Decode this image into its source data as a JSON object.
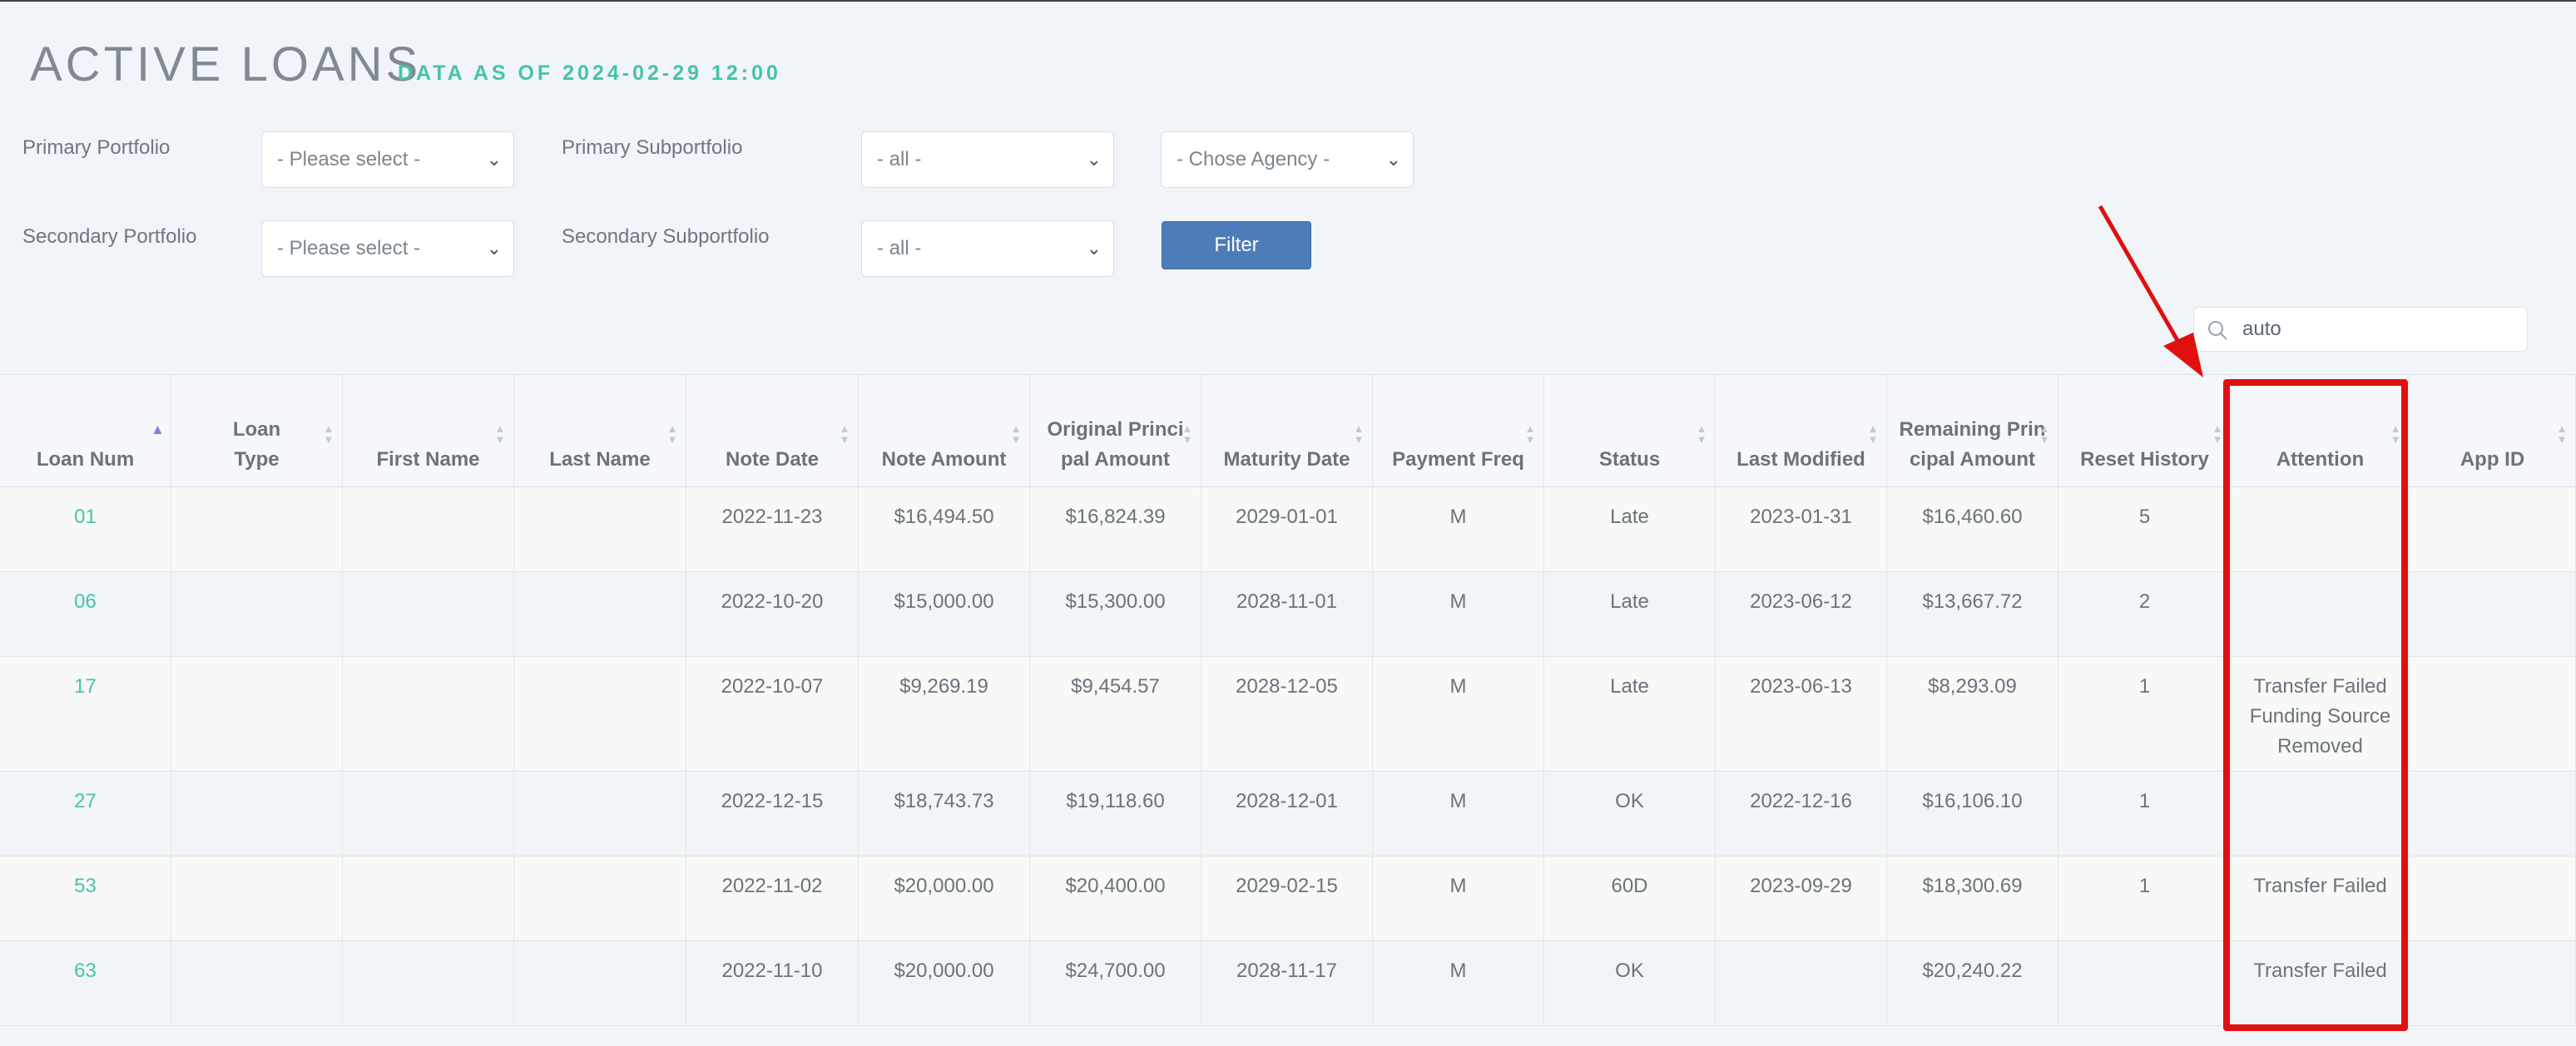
{
  "header": {
    "title": "ACTIVE LOANS",
    "subtitle": "DATA AS OF 2024-02-29 12:00"
  },
  "filters": {
    "primary_portfolio_label": "Primary Portfolio",
    "primary_portfolio_value": "- Please select -",
    "primary_subportfolio_label": "Primary Subportfolio",
    "primary_subportfolio_value": "- all -",
    "agency_value": "- Chose Agency -",
    "secondary_portfolio_label": "Secondary Portfolio",
    "secondary_portfolio_value": "- Please select -",
    "secondary_subportfolio_label": "Secondary Subportfolio",
    "secondary_subportfolio_value": "- all -",
    "filter_button": "Filter"
  },
  "search": {
    "value": "auto"
  },
  "table": {
    "columns": [
      {
        "label": "Loan Num"
      },
      {
        "label": "Loan Type"
      },
      {
        "label": "First Name"
      },
      {
        "label": "Last Name"
      },
      {
        "label": "Note Date"
      },
      {
        "label": "Note Amount"
      },
      {
        "label": "Original Principal Amount"
      },
      {
        "label": "Maturity Date"
      },
      {
        "label": "Payment Freq"
      },
      {
        "label": "Status"
      },
      {
        "label": "Last Modified"
      },
      {
        "label": "Remaining Principal Amount"
      },
      {
        "label": "Reset History"
      },
      {
        "label": "Attention"
      },
      {
        "label": "App ID"
      }
    ],
    "rows": [
      {
        "loan": "01",
        "type": "",
        "first": "",
        "last": "",
        "note_date": "2022-11-23",
        "note_amount": "$16,494.50",
        "orig_principal": "$16,824.39",
        "maturity": "2029-01-01",
        "freq": "M",
        "status": "Late",
        "last_modified": "2023-01-31",
        "remaining": "$16,460.60",
        "reset": "5",
        "attention": "",
        "app_id": ""
      },
      {
        "loan": "06",
        "type": "",
        "first": "",
        "last": "",
        "note_date": "2022-10-20",
        "note_amount": "$15,000.00",
        "orig_principal": "$15,300.00",
        "maturity": "2028-11-01",
        "freq": "M",
        "status": "Late",
        "last_modified": "2023-06-12",
        "remaining": "$13,667.72",
        "reset": "2",
        "attention": "",
        "app_id": ""
      },
      {
        "loan": "17",
        "type": "",
        "first": "",
        "last": "",
        "note_date": "2022-10-07",
        "note_amount": "$9,269.19",
        "orig_principal": "$9,454.57",
        "maturity": "2028-12-05",
        "freq": "M",
        "status": "Late",
        "last_modified": "2023-06-13",
        "remaining": "$8,293.09",
        "reset": "1",
        "attention": "Transfer Failed Funding Source Removed",
        "app_id": ""
      },
      {
        "loan": "27",
        "type": "",
        "first": "",
        "last": "",
        "note_date": "2022-12-15",
        "note_amount": "$18,743.73",
        "orig_principal": "$19,118.60",
        "maturity": "2028-12-01",
        "freq": "M",
        "status": "OK",
        "last_modified": "2022-12-16",
        "remaining": "$16,106.10",
        "reset": "1",
        "attention": "",
        "app_id": ""
      },
      {
        "loan": "53",
        "type": "",
        "first": "",
        "last": "",
        "note_date": "2022-11-02",
        "note_amount": "$20,000.00",
        "orig_principal": "$20,400.00",
        "maturity": "2029-02-15",
        "freq": "M",
        "status": "60D",
        "last_modified": "2023-09-29",
        "remaining": "$18,300.69",
        "reset": "1",
        "attention": "Transfer Failed",
        "app_id": ""
      },
      {
        "loan": "63",
        "type": "",
        "first": "",
        "last": "",
        "note_date": "2022-11-10",
        "note_amount": "$20,000.00",
        "orig_principal": "$24,700.00",
        "maturity": "2028-11-17",
        "freq": "M",
        "status": "OK",
        "last_modified": "",
        "remaining": "$20,240.22",
        "reset": "",
        "attention": "Transfer Failed",
        "app_id": ""
      }
    ]
  },
  "colors": {
    "accent": "#46c3a8",
    "filter_button": "#4d7db8",
    "highlight": "#e01010"
  }
}
